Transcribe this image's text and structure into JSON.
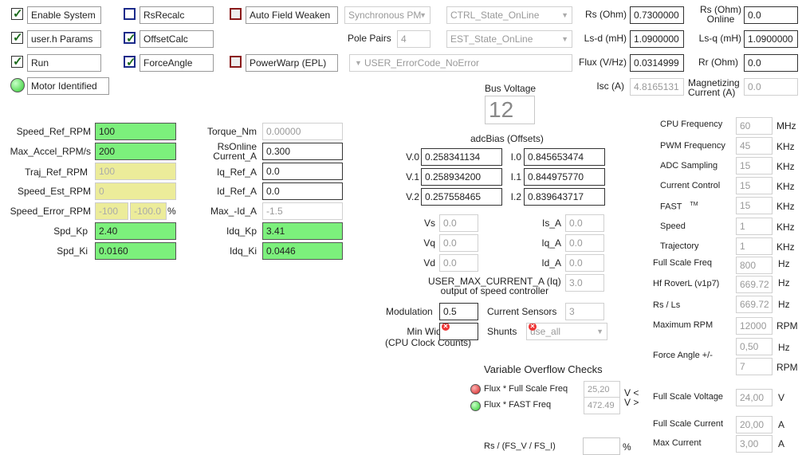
{
  "checks": {
    "enable_system": {
      "label": "Enable System",
      "checked": true
    },
    "user_params": {
      "label": "user.h Params",
      "checked": true
    },
    "run": {
      "label": "Run",
      "checked": true
    },
    "rs_recalc": {
      "label": "RsRecalc",
      "checked": false
    },
    "offset_calc": {
      "label": "OffsetCalc",
      "checked": true
    },
    "force_angle": {
      "label": "ForceAngle",
      "checked": true
    },
    "auto_field_weaken": {
      "label": "Auto Field Weaken",
      "checked": false
    },
    "power_warp": {
      "label": "PowerWarp (EPL)",
      "checked": false
    }
  },
  "motor_identified": "Motor Identified",
  "motor_type": "Synchronous PM",
  "ctrl_state": "CTRL_State_OnLine",
  "est_state": "EST_State_OnLine",
  "pole_pairs": {
    "label": "Pole Pairs",
    "value": "4"
  },
  "error_code": "USER_ErrorCode_NoError",
  "motor_params": {
    "rs": {
      "label": "Rs (Ohm)",
      "value": "0.7300000"
    },
    "ls_d": {
      "label": "Ls-d (mH)",
      "value": "1.0900000"
    },
    "flux": {
      "label": "Flux (V/Hz)",
      "value": "0.0314999"
    },
    "isc": {
      "label": "Isc (A)",
      "value": "4.8165131"
    },
    "rs_online": {
      "label1": "Rs (Ohm)",
      "label2": "Online",
      "value": "0.0"
    },
    "ls_q": {
      "label": "Ls-q (mH)",
      "value": "1.0900000"
    },
    "rr": {
      "label": "Rr (Ohm)",
      "value": "0.0"
    },
    "magnetizing": {
      "label1": "Magnetizing",
      "label2": "Current (A)",
      "value": "0.0"
    }
  },
  "bus_voltage": {
    "label": "Bus Voltage",
    "value": "12"
  },
  "speed": {
    "speed_ref": {
      "label": "Speed_Ref_RPM",
      "value": "100"
    },
    "max_accel": {
      "label": "Max_Accel_RPM/s",
      "value": "200"
    },
    "traj_ref": {
      "label": "Traj_Ref_RPM",
      "value": "100"
    },
    "speed_est": {
      "label": "Speed_Est_RPM",
      "value": "0"
    },
    "speed_error": {
      "label": "Speed_Error_RPM",
      "value1": "-100",
      "value2": "-100.0",
      "unit": "%"
    },
    "spd_kp": {
      "label": "Spd_Kp",
      "value": "2.40"
    },
    "spd_ki": {
      "label": "Spd_Ki",
      "value": "0.0160"
    }
  },
  "torque": {
    "torque_nm": {
      "label": "Torque_Nm",
      "value": "0.00000"
    },
    "rsonline_current": {
      "label1": "RsOnline",
      "label2": "Current_A",
      "value": "0.300"
    },
    "iq_ref": {
      "label": "Iq_Ref_A",
      "value": "0.0"
    },
    "id_ref": {
      "label": "Id_Ref_A",
      "value": "0.0"
    },
    "max_id": {
      "label": "Max_-Id_A",
      "value": "-1.5"
    },
    "idq_kp": {
      "label": "Idq_Kp",
      "value": "3.41"
    },
    "idq_ki": {
      "label": "Idq_Ki",
      "value": "0.0446"
    }
  },
  "adc_bias": {
    "title": "adcBias (Offsets)",
    "v0": {
      "label": "V.0",
      "value": "0.258341134"
    },
    "v1": {
      "label": "V.1",
      "value": "0.258934200"
    },
    "v2": {
      "label": "V.2",
      "value": "0.257558465"
    },
    "i0": {
      "label": "I.0",
      "value": "0.845653474"
    },
    "i1": {
      "label": "I.1",
      "value": "0.844975770"
    },
    "i2": {
      "label": "I.2",
      "value": "0.839643717"
    }
  },
  "voltages": {
    "vs": {
      "label": "Vs",
      "value": "0.0"
    },
    "vq": {
      "label": "Vq",
      "value": "0.0"
    },
    "vd": {
      "label": "Vd",
      "value": "0.0"
    },
    "is_a": {
      "label": "Is_A",
      "value": "0.0"
    },
    "iq_a": {
      "label": "Iq_A",
      "value": "0.0"
    },
    "id_a": {
      "label": "Id_A",
      "value": "0.0"
    }
  },
  "user_max_current": {
    "label1": "USER_MAX_CURRENT_A (Iq)",
    "label2": "output of speed controller",
    "value": "3.0"
  },
  "modulation": {
    "label": "Modulation",
    "value": "0.5"
  },
  "current_sensors": {
    "label": "Current Sensors",
    "value": "3"
  },
  "min_width": {
    "label1": "Min Width",
    "label2": "(CPU Clock Counts)",
    "value": ""
  },
  "shunts": {
    "label": "Shunts",
    "value": "use_all"
  },
  "overflow": {
    "title": "Variable Overflow Checks",
    "flux_fs": {
      "label": "Flux * Full Scale Freq",
      "value": "25,20",
      "cmp": "V <",
      "status": "red"
    },
    "flux_fast": {
      "label": "Flux * FAST Freq",
      "value": "472.49",
      "cmp": "V >",
      "status": "green"
    },
    "rs_ratio": {
      "label": "Rs / (FS_V / FS_I)",
      "value": "",
      "unit": "%"
    }
  },
  "system": {
    "cpu_freq": {
      "label": "CPU Frequency",
      "value": "60",
      "unit": "MHz"
    },
    "pwm_freq": {
      "label": "PWM Frequency",
      "value": "45",
      "unit": "KHz"
    },
    "adc_sampling": {
      "label": "ADC Sampling",
      "value": "15",
      "unit": "KHz"
    },
    "current_control": {
      "label": "Current Control",
      "value": "15",
      "unit": "KHz"
    },
    "fast": {
      "label": "FAST",
      "tm": "TM",
      "value": "15",
      "unit": "KHz"
    },
    "speed": {
      "label": "Speed",
      "value": "1",
      "unit": "KHz"
    },
    "trajectory": {
      "label": "Trajectory",
      "value": "1",
      "unit": "KHz"
    },
    "full_scale_freq": {
      "label": "Full Scale Freq",
      "value": "800",
      "unit": "Hz"
    },
    "hf_roverl": {
      "label": "Hf RoverL (v1p7)",
      "value": "669.72",
      "unit": "Hz"
    },
    "rs_ls": {
      "label": "Rs / Ls",
      "value": "669.72",
      "unit": "Hz"
    },
    "max_rpm": {
      "label": "Maximum RPM",
      "value": "12000",
      "unit": "RPM"
    },
    "force_angle_hz": {
      "value": "0,50",
      "unit": "Hz"
    },
    "force_angle": {
      "label": "Force Angle +/-",
      "value": "7",
      "unit": "RPM"
    },
    "full_scale_voltage": {
      "label": "Full Scale Voltage",
      "value": "24,00",
      "unit": "V"
    },
    "full_scale_current": {
      "label": "Full Scale Current",
      "value": "20,00",
      "unit": "A"
    },
    "max_current": {
      "label": "Max Current",
      "value": "3,00",
      "unit": "A"
    }
  }
}
